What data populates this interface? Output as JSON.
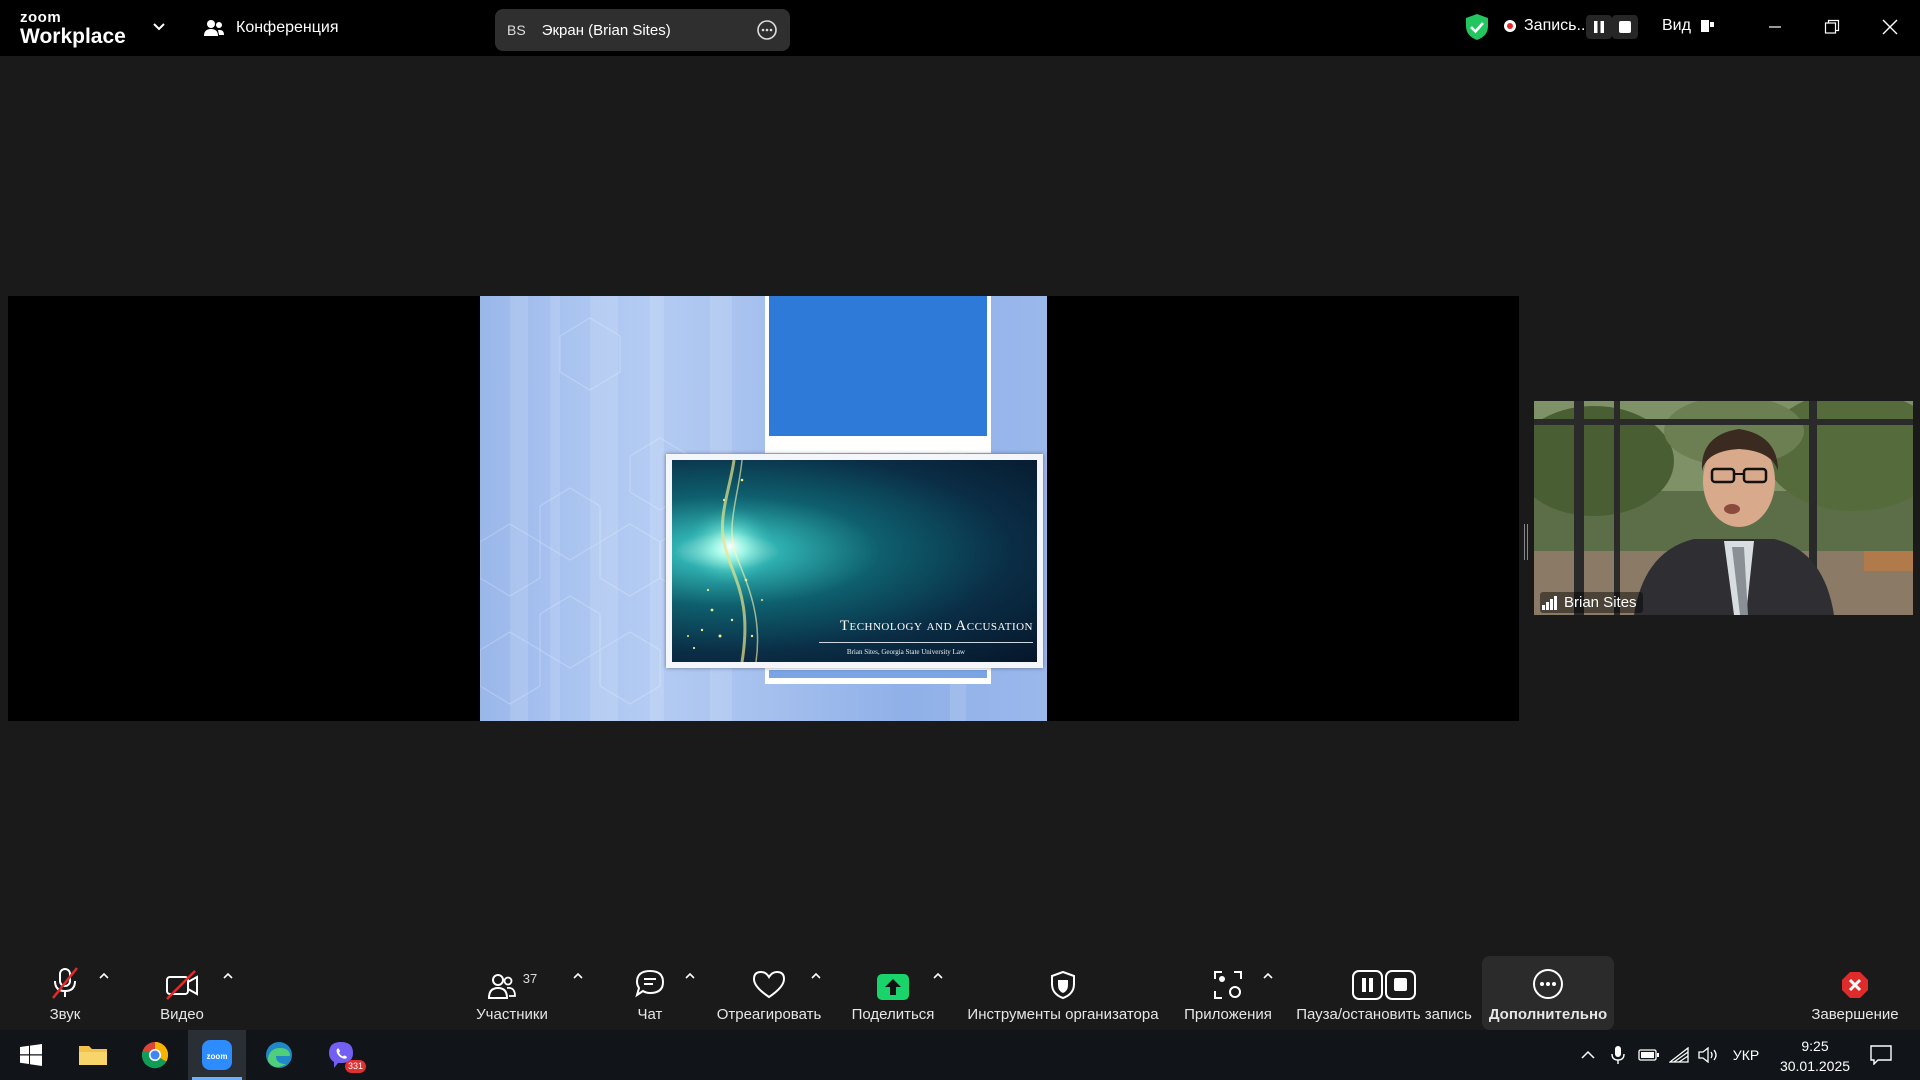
{
  "titlebar": {
    "brand_top": "zoom",
    "brand_bottom": "Workplace",
    "meeting_label": "Конференция",
    "screen_share": {
      "initials": "BS",
      "label": "Экран (Brian Sites)"
    },
    "recording_label": "Запись...",
    "view_label": "Вид"
  },
  "slide": {
    "title": "Technology and Accusation",
    "subtitle": "Brian Sites, Georgia State University Law"
  },
  "participant": {
    "name": "Brian Sites"
  },
  "toolbar": {
    "audio": "Звук",
    "video": "Видео",
    "participants": "Участники",
    "participants_count": "37",
    "chat": "Чат",
    "react": "Отреагировать",
    "share": "Поделиться",
    "host_tools": "Инструменты организатора",
    "apps": "Приложения",
    "pause_stop_recording": "Пауза/остановить запись",
    "more": "Дополнительно",
    "end": "Завершение"
  },
  "taskbar": {
    "viber_badge": "331",
    "language": "УКР",
    "time": "9:25",
    "date": "30.01.2025"
  },
  "colors": {
    "accent_green": "#22c55e",
    "share_green": "#19d46b",
    "end_red": "#e02b2b",
    "muted_red": "#e02b2b",
    "slide_blue": "#2e7ad8"
  },
  "icons": {
    "audio": "mic-muted-icon",
    "video": "camera-off-icon",
    "participants": "people-icon",
    "chat": "chat-bubble-icon",
    "react": "heart-icon",
    "share": "share-arrow-icon",
    "host_tools": "shield-icon",
    "apps": "apps-icon",
    "recording": "pause-stop-icon",
    "more": "ellipsis-icon",
    "end": "close-icon"
  }
}
